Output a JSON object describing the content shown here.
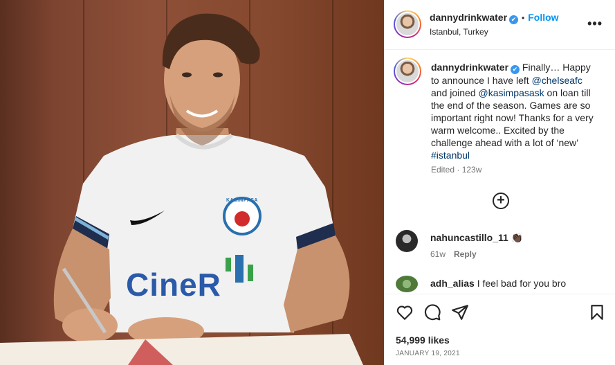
{
  "post": {
    "username": "dannydrinkwater",
    "verified_mark": "✔",
    "follow_label": "Follow",
    "dot": "•",
    "location": "Istanbul, Turkey",
    "more_label": "•••"
  },
  "photo": {
    "shirt_sponsor": "CineR",
    "club_crest_text": "KASIMPAŞA"
  },
  "caption": {
    "username": "dannydrinkwater",
    "text_1": "Finally… Happy to announce I have left ",
    "mention_1": "@chelseafc",
    "text_2": " and joined ",
    "mention_2": "@kasimpasask",
    "text_3": " on loan till the end of the season. Games are so important right now! Thanks for a very warm welcome.. Excited by the challenge ahead with a lot of ‘new’ ",
    "hashtag": "#istanbul",
    "meta": "Edited · 123w"
  },
  "load_more_label": "+",
  "comments": [
    {
      "username": "nahuncastillo_11",
      "text": "👏🏿",
      "age": "61w",
      "reply_label": "Reply"
    },
    {
      "username": "adh_alias",
      "text": "I feel bad for you bro"
    }
  ],
  "footer": {
    "likes": "54,999 likes",
    "date": "JANUARY 19, 2021"
  },
  "icons": {
    "like": "heart-icon",
    "comment": "comment-icon",
    "share": "share-icon",
    "save": "bookmark-icon"
  },
  "colors": {
    "accent": "#0095f6",
    "mention": "#00376b",
    "muted": "#737373"
  }
}
